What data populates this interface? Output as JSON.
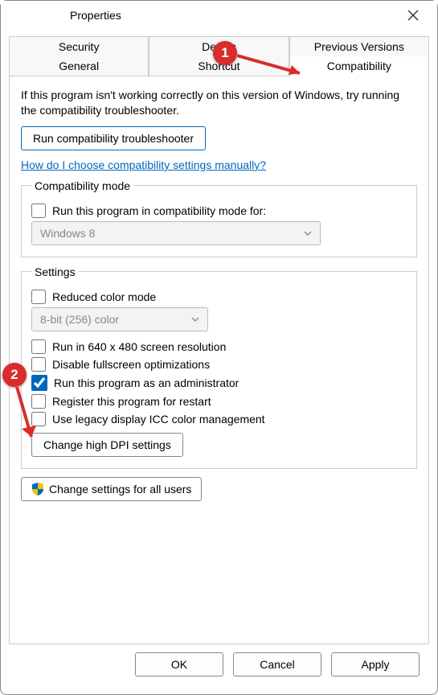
{
  "window": {
    "title": "Properties"
  },
  "tabs": {
    "row1": [
      "Security",
      "Details",
      "Previous Versions"
    ],
    "row2": [
      "General",
      "Shortcut",
      "Compatibility"
    ]
  },
  "intro": "If this program isn't working correctly on this version of Windows, try running the compatibility troubleshooter.",
  "run_troubleshooter": "Run compatibility troubleshooter",
  "help_link": "How do I choose compatibility settings manually?",
  "compat_mode": {
    "legend": "Compatibility mode",
    "checkbox": "Run this program in compatibility mode for:",
    "select": "Windows 8"
  },
  "settings": {
    "legend": "Settings",
    "reduced_color": "Reduced color mode",
    "color_select": "8-bit (256) color",
    "run_640": "Run in 640 x 480 screen resolution",
    "disable_fs": "Disable fullscreen optimizations",
    "run_admin": "Run this program as an administrator",
    "register_restart": "Register this program for restart",
    "legacy_icc": "Use legacy display ICC color management",
    "dpi_btn": "Change high DPI settings"
  },
  "all_users_btn": "Change settings for all users",
  "footer": {
    "ok": "OK",
    "cancel": "Cancel",
    "apply": "Apply"
  },
  "annotations": {
    "c1": "1",
    "c2": "2"
  }
}
